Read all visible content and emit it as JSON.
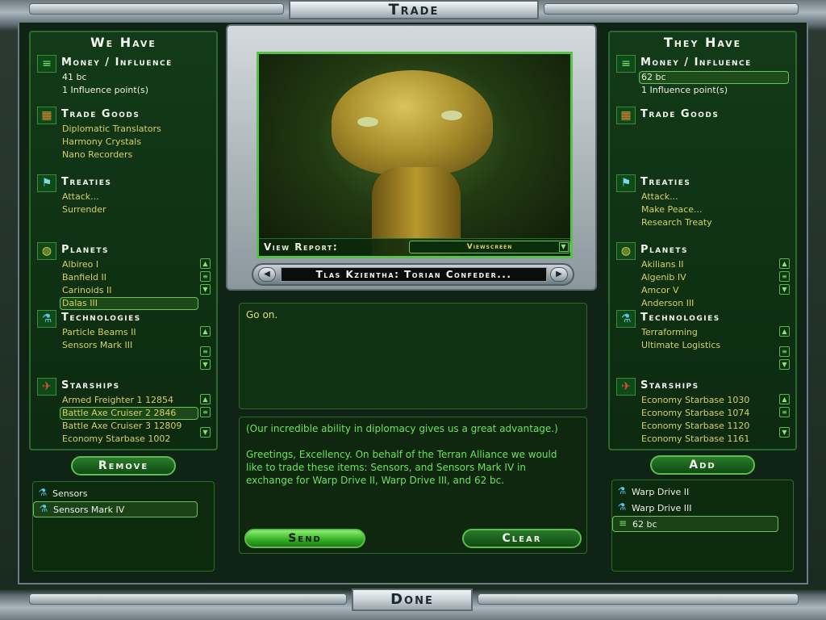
{
  "window": {
    "title": "Trade",
    "done_label": "Done"
  },
  "we_have": {
    "title": "We Have",
    "money": {
      "title": "Money / Influence",
      "items": [
        "41 bc",
        "1 Influence point(s)"
      ]
    },
    "trade_goods": {
      "title": "Trade Goods",
      "items": [
        "Diplomatic Translators",
        "Harmony Crystals",
        "Nano Recorders"
      ]
    },
    "treaties": {
      "title": "Treaties",
      "items": [
        "Attack...",
        "Surrender"
      ]
    },
    "planets": {
      "title": "Planets",
      "items": [
        "Albireo I",
        "Banfield II",
        "Carinoids II",
        "Dalas III"
      ]
    },
    "technologies": {
      "title": "Technologies",
      "items": [
        "Particle Beams II",
        "Sensors Mark III"
      ]
    },
    "starships": {
      "title": "Starships",
      "items": [
        "Armed Freighter 1 12854",
        "Battle Axe Cruiser 2 2846",
        "Battle Axe Cruiser 3 12809",
        "Economy Starbase 1002"
      ]
    },
    "action_label": "Remove",
    "offer": [
      {
        "label": "Sensors",
        "icon": "flask-icon"
      },
      {
        "label": "Sensors Mark IV",
        "icon": "flask-icon"
      }
    ]
  },
  "they_have": {
    "title": "They Have",
    "money": {
      "title": "Money / Influence",
      "items": [
        "62 bc",
        "1 Influence point(s)"
      ]
    },
    "trade_goods": {
      "title": "Trade Goods",
      "items": []
    },
    "treaties": {
      "title": "Treaties",
      "items": [
        "Attack...",
        "Make Peace...",
        "Research Treaty"
      ]
    },
    "planets": {
      "title": "Planets",
      "items": [
        "Akilians II",
        "Algenib IV",
        "Amcor V",
        "Anderson III"
      ]
    },
    "technologies": {
      "title": "Technologies",
      "items": [
        "Terraforming",
        "Ultimate Logistics"
      ]
    },
    "starships": {
      "title": "Starships",
      "items": [
        "Economy Starbase 1030",
        "Economy Starbase 1074",
        "Economy Starbase 1120",
        "Economy Starbase 1161"
      ]
    },
    "action_label": "Add",
    "offer": [
      {
        "label": "Warp Drive II",
        "icon": "flask-icon"
      },
      {
        "label": "Warp Drive III",
        "icon": "flask-icon"
      },
      {
        "label": "62 bc",
        "icon": "money-icon"
      }
    ]
  },
  "viewer": {
    "view_report_label": "View Report:",
    "view_report_value": "Viewscreen",
    "race_name": "Tlas Kzientha: Torian Confeder..."
  },
  "dialog": {
    "response": "Go on.",
    "message_line1": "(Our incredible ability in diplomacy gives us a great advantage.)",
    "message_line2": "Greetings, Excellency. On behalf of the Terran Alliance we would like to trade these items: Sensors, and Sensors Mark IV in exchange for Warp Drive II, Warp Drive III, and 62 bc.",
    "send_label": "Send",
    "clear_label": "Clear"
  },
  "colors": {
    "accent_green": "#5cbf4d",
    "item_yellow": "#d9cf62",
    "message_green": "#6ce35d"
  }
}
